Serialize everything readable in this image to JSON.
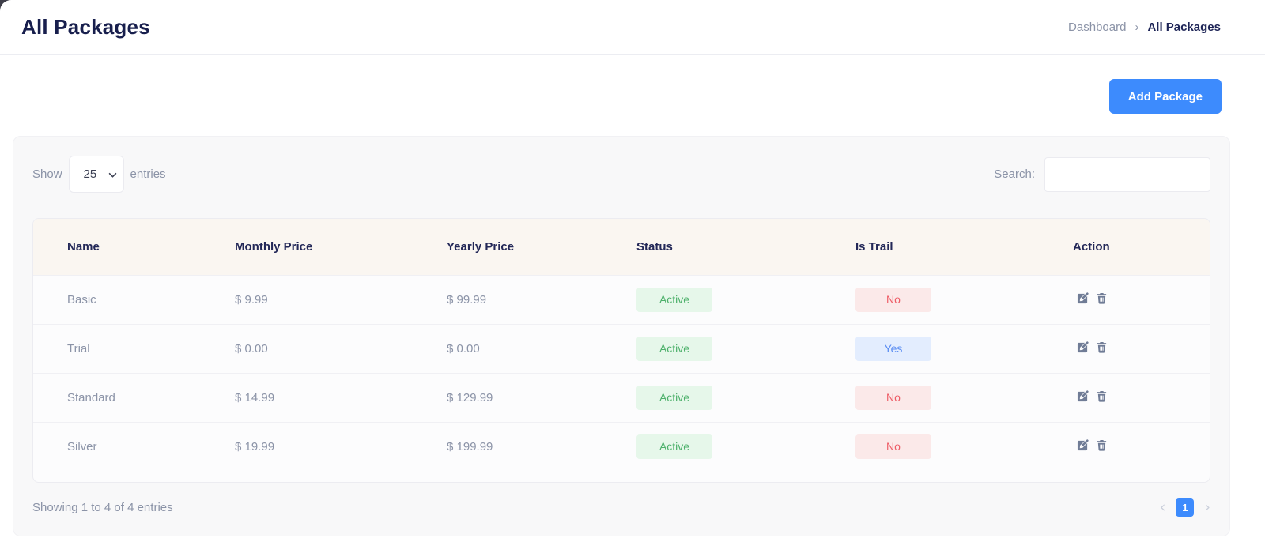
{
  "header": {
    "title": "All Packages",
    "breadcrumb": {
      "parent": "Dashboard",
      "separator": "›",
      "current": "All Packages"
    }
  },
  "toolbar": {
    "add_button_label": "Add Package"
  },
  "table_card": {
    "show_label": "Show",
    "entries_label": "entries",
    "page_size": "25",
    "search_label": "Search:",
    "search_value": "",
    "columns": [
      "Name",
      "Monthly Price",
      "Yearly Price",
      "Status",
      "Is Trail",
      "Action"
    ],
    "rows": [
      {
        "name": "Basic",
        "monthly": "$ 9.99",
        "yearly": "$ 99.99",
        "status": "Active",
        "is_trail": "No"
      },
      {
        "name": "Trial",
        "monthly": "$ 0.00",
        "yearly": "$ 0.00",
        "status": "Active",
        "is_trail": "Yes"
      },
      {
        "name": "Standard",
        "monthly": "$ 14.99",
        "yearly": "$ 129.99",
        "status": "Active",
        "is_trail": "No"
      },
      {
        "name": "Silver",
        "monthly": "$ 19.99",
        "yearly": "$ 199.99",
        "status": "Active",
        "is_trail": "No"
      }
    ],
    "footer": {
      "summary": "Showing 1 to 4 of 4 entries",
      "prev_icon": "‹",
      "current_page": "1",
      "next_icon": "›"
    }
  },
  "colors": {
    "accent_blue": "#3d8bfd",
    "badge_green_bg": "#e6f7ea",
    "badge_green_text": "#4cb06a",
    "badge_red_bg": "#fbe9e9",
    "badge_red_text": "#ee5c66",
    "badge_blue_bg": "#e3edfe",
    "badge_blue_text": "#5b8df2",
    "title_navy": "#181f4d",
    "muted_text": "#8b93a7"
  }
}
